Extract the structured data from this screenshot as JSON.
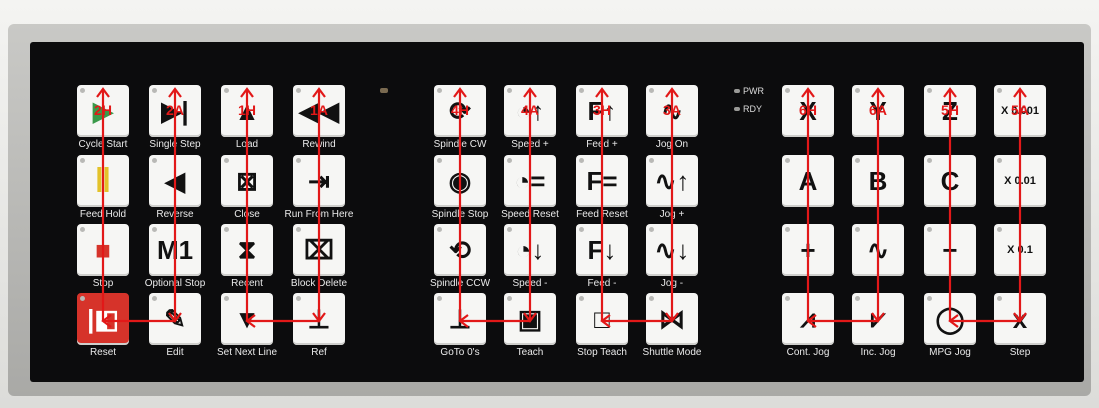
{
  "status": {
    "pwr": "PWR",
    "rdy": "RDY"
  },
  "keys": [
    {
      "id": "cycle-start",
      "label": "Cycle Start",
      "ann": "2H",
      "glyph": "▶",
      "style": "green"
    },
    {
      "id": "single-step",
      "label": "Single Step",
      "ann": "2A",
      "glyph": "▶|"
    },
    {
      "id": "load",
      "label": "Load",
      "ann": "1H",
      "glyph": "▲"
    },
    {
      "id": "rewind",
      "label": "Rewind",
      "ann": "1A",
      "glyph": "◀◀"
    },
    {
      "id": "feed-hold",
      "label": "Feed Hold",
      "ann": "",
      "glyph": "‖",
      "style": "yellow"
    },
    {
      "id": "reverse",
      "label": "Reverse",
      "ann": "",
      "glyph": "◀"
    },
    {
      "id": "close",
      "label": "Close",
      "ann": "",
      "glyph": "⊠"
    },
    {
      "id": "run-from-here",
      "label": "Run From Here",
      "ann": "",
      "glyph": "⇥"
    },
    {
      "id": "stop",
      "label": "Stop",
      "ann": "",
      "glyph": "■",
      "style": "redsq"
    },
    {
      "id": "optional-stop",
      "label": "Optional Stop",
      "ann": "",
      "glyph": "M1"
    },
    {
      "id": "recent",
      "label": "Recent",
      "ann": "",
      "glyph": "⧗"
    },
    {
      "id": "block-delete",
      "label": "Block Delete",
      "ann": "",
      "glyph": "⌧"
    },
    {
      "id": "reset",
      "label": "Reset",
      "ann": "",
      "glyph": "|◧",
      "style": "red"
    },
    {
      "id": "edit",
      "label": "Edit",
      "ann": "",
      "glyph": "✎"
    },
    {
      "id": "set-next-line",
      "label": "Set Next Line",
      "ann": "",
      "glyph": "▼"
    },
    {
      "id": "ref",
      "label": "Ref",
      "ann": "",
      "glyph": "⊥"
    },
    {
      "id": "spindle-cw",
      "label": "Spindle CW",
      "ann": "4H",
      "glyph": "⟳"
    },
    {
      "id": "speed-plus",
      "label": "Speed +",
      "ann": "4A",
      "glyph": "◔↑"
    },
    {
      "id": "feed-plus",
      "label": "Feed +",
      "ann": "3H",
      "glyph": "F↑"
    },
    {
      "id": "jog-on",
      "label": "Jog On",
      "ann": "3A",
      "glyph": "∿"
    },
    {
      "id": "spindle-stop",
      "label": "Spindle Stop",
      "ann": "",
      "glyph": "◉"
    },
    {
      "id": "speed-reset",
      "label": "Speed Reset",
      "ann": "",
      "glyph": "◔="
    },
    {
      "id": "feed-reset",
      "label": "Feed Reset",
      "ann": "",
      "glyph": "F="
    },
    {
      "id": "jog-plus",
      "label": "Jog +",
      "ann": "",
      "glyph": "∿↑"
    },
    {
      "id": "spindle-ccw",
      "label": "Spindle CCW",
      "ann": "",
      "glyph": "⟲"
    },
    {
      "id": "speed-minus",
      "label": "Speed -",
      "ann": "",
      "glyph": "◔↓"
    },
    {
      "id": "feed-minus",
      "label": "Feed -",
      "ann": "",
      "glyph": "F↓"
    },
    {
      "id": "jog-minus",
      "label": "Jog -",
      "ann": "",
      "glyph": "∿↓"
    },
    {
      "id": "goto-zero",
      "label": "GoTo 0's",
      "ann": "",
      "glyph": "⊥"
    },
    {
      "id": "teach",
      "label": "Teach",
      "ann": "",
      "glyph": "▣"
    },
    {
      "id": "stop-teach",
      "label": "Stop Teach",
      "ann": "",
      "glyph": "□"
    },
    {
      "id": "shuttle-mode",
      "label": "Shuttle Mode",
      "ann": "",
      "glyph": "⋈"
    },
    {
      "id": "axis-x",
      "label": "",
      "ann": "6H",
      "glyph": "X"
    },
    {
      "id": "axis-y",
      "label": "",
      "ann": "6A",
      "glyph": "Y"
    },
    {
      "id": "axis-z",
      "label": "",
      "ann": "5H",
      "glyph": "Z"
    },
    {
      "id": "step-0001",
      "label": "",
      "ann": "5A",
      "glyph": "X 0.001",
      "style": "sm"
    },
    {
      "id": "axis-a",
      "label": "",
      "ann": "",
      "glyph": "A"
    },
    {
      "id": "axis-b",
      "label": "",
      "ann": "",
      "glyph": "B"
    },
    {
      "id": "axis-c",
      "label": "",
      "ann": "",
      "glyph": "C"
    },
    {
      "id": "step-001",
      "label": "",
      "ann": "",
      "glyph": "X 0.01",
      "style": "sm"
    },
    {
      "id": "plus",
      "label": "",
      "ann": "",
      "glyph": "+"
    },
    {
      "id": "wave",
      "label": "",
      "ann": "",
      "glyph": "∿"
    },
    {
      "id": "minus",
      "label": "",
      "ann": "",
      "glyph": "−"
    },
    {
      "id": "step-01",
      "label": "",
      "ann": "",
      "glyph": "X 0.1",
      "style": "sm"
    },
    {
      "id": "cont-jog",
      "label": "Cont. Jog",
      "ann": "",
      "glyph": "⩘"
    },
    {
      "id": "inc-jog",
      "label": "Inc. Jog",
      "ann": "",
      "glyph": "⩗"
    },
    {
      "id": "mpg-jog",
      "label": "MPG Jog",
      "ann": "",
      "glyph": "◯"
    },
    {
      "id": "step",
      "label": "Step",
      "ann": "",
      "glyph": "x"
    }
  ]
}
